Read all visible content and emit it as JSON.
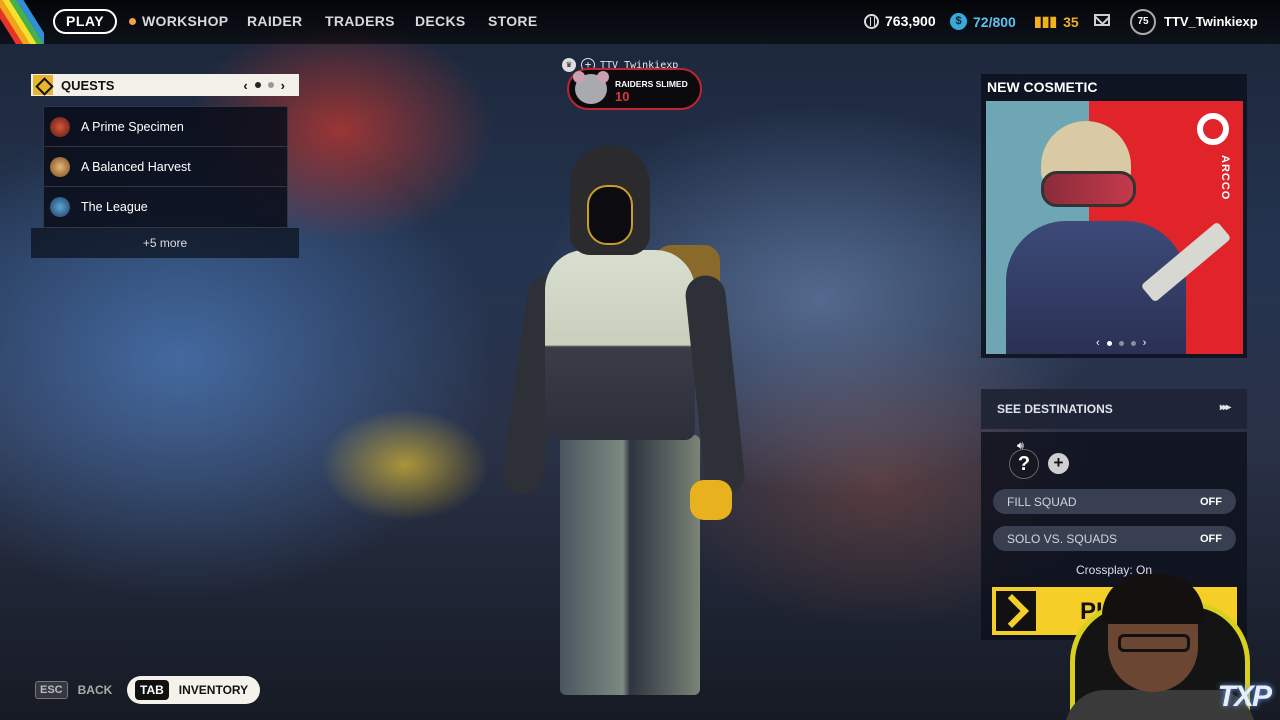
{
  "nav": {
    "play": "PLAY",
    "workshop": "WORKSHOP",
    "raider": "RAIDER",
    "traders": "TRADERS",
    "decks": "DECKS",
    "store": "STORE"
  },
  "currency": {
    "coins": "763,900",
    "tokens": "72/800",
    "cred": "35"
  },
  "profile": {
    "level": "75",
    "username": "TTV_Twinkiexp"
  },
  "quests": {
    "title": "QUESTS",
    "page_prev": "‹",
    "page_next": "›",
    "items": [
      {
        "label": "A Prime Specimen",
        "color": "#a83a2a"
      },
      {
        "label": "A Balanced Harvest",
        "color": "#c9934a"
      },
      {
        "label": "The League",
        "color": "#3f7aa8"
      }
    ],
    "more": "+5 more"
  },
  "notification": {
    "player": "TTV_Twinkiexp",
    "label": "RAIDERS SLIMED",
    "count": "10"
  },
  "cosmetic": {
    "title": "NEW COSMETIC",
    "brand": "ARCCO",
    "prev": "‹",
    "next": "›"
  },
  "matchmaking": {
    "destinations": "SEE DESTINATIONS",
    "destinations_arrows": "▸▸▸",
    "unknown_slot": "?",
    "add_slot": "+",
    "fill_squad": "FILL SQUAD",
    "fill_squad_state": "OFF",
    "solo_vs_squads": "SOLO VS. SQUADS",
    "solo_vs_squads_state": "OFF",
    "crossplay": "Crossplay: On",
    "play": "PL"
  },
  "hints": {
    "esc_key": "ESC",
    "esc_label": "BACK",
    "tab_key": "TAB",
    "tab_label": "INVENTORY"
  },
  "overlay": {
    "logo": "TXP"
  },
  "colors": {
    "accent_yellow": "#f5cf28",
    "alert_red": "#c02432",
    "stripes": [
      "#e8332a",
      "#f2a21b",
      "#f6e12a",
      "#46b04a",
      "#2f8fd8"
    ]
  }
}
